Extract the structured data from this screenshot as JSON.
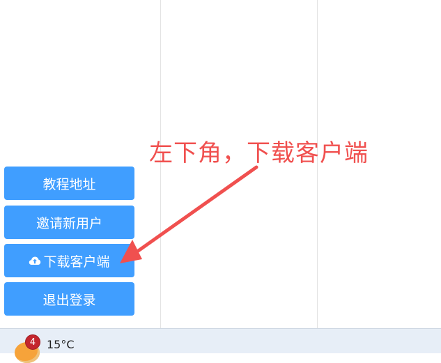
{
  "sidebar": {
    "items": [
      {
        "label": "教程地址"
      },
      {
        "label": "邀请新用户"
      },
      {
        "label": "下载客户端",
        "icon": "cloud-upload-icon"
      },
      {
        "label": "退出登录"
      }
    ]
  },
  "annotation": {
    "text": "左下角，下载客户端",
    "color": "#f0504f"
  },
  "taskbar": {
    "weather": {
      "icon": "sun-weather-icon",
      "temperature": "15°C",
      "badge_count": "4"
    }
  },
  "colors": {
    "button": "#409eff",
    "badge": "#c4262e",
    "taskbar": "#e7eef7"
  }
}
